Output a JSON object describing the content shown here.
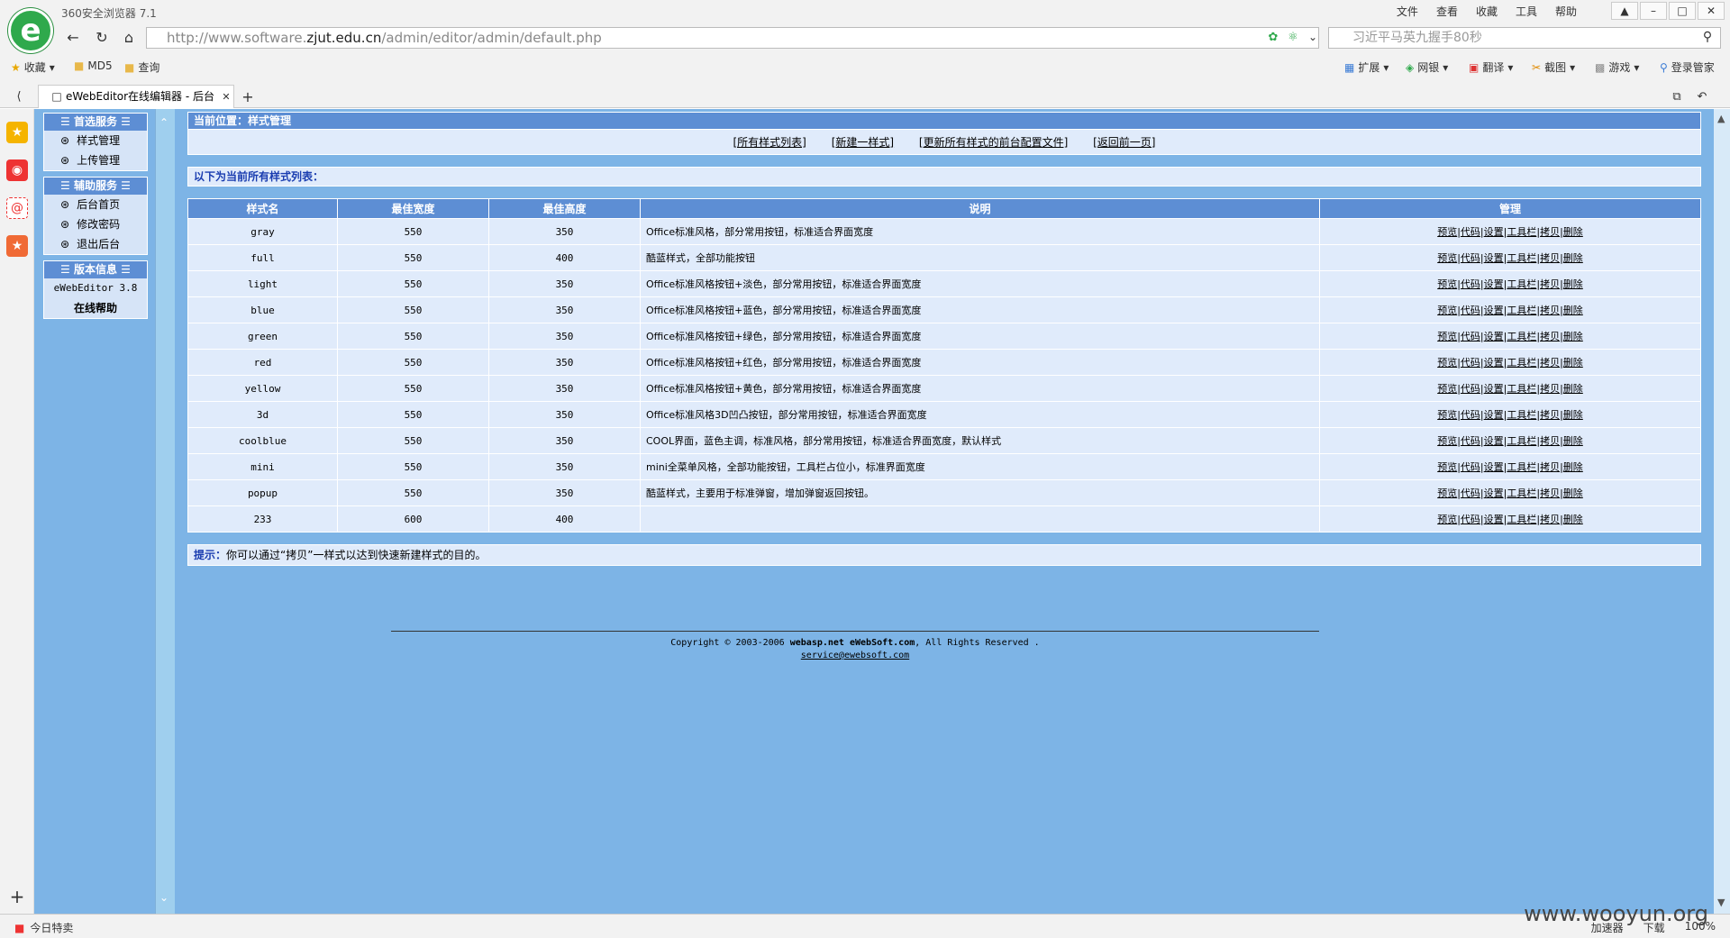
{
  "browser": {
    "app_name": "360安全浏览器 7.1",
    "menus": [
      "文件",
      "查看",
      "收藏",
      "工具",
      "帮助"
    ],
    "url_prefix": "http://www.software.",
    "url_host": "zjut.edu.cn",
    "url_path": "/admin/editor/admin/default.php",
    "search_text": "习近平马英九握手80秒",
    "bookmarks": [
      "收藏",
      "MD5",
      "查询"
    ],
    "toolbar_items": [
      "扩展",
      "网银",
      "翻译",
      "截图",
      "游戏",
      "登录管家"
    ],
    "tab_title": "eWebEditor在线编辑器 - 后台",
    "status_left": "今日特卖",
    "status_right": [
      "加速器",
      "下载",
      "100%"
    ],
    "watermark": "www.wooyun.org"
  },
  "sidebar": {
    "sections": [
      {
        "title": "首选服务",
        "items": [
          "样式管理",
          "上传管理"
        ]
      },
      {
        "title": "辅助服务",
        "items": [
          "后台首页",
          "修改密码",
          "退出后台"
        ]
      }
    ],
    "version_title": "版本信息",
    "version_text": "eWebEditor 3.8",
    "help_text": "在线帮助"
  },
  "main": {
    "location": "当前位置：样式管理",
    "links": [
      "[所有样式列表]",
      "[新建一样式]",
      "[更新所有样式的前台配置文件]",
      "[返回前一页]"
    ],
    "list_header": "以下为当前所有样式列表：",
    "columns": [
      "样式名",
      "最佳宽度",
      "最佳高度",
      "说明",
      "管理"
    ],
    "actions": [
      "预览",
      "代码",
      "设置",
      "工具栏",
      "拷贝",
      "删除"
    ],
    "rows": [
      {
        "name": "gray",
        "width": "550",
        "height": "350",
        "desc": "Office标准风格，部分常用按钮，标准适合界面宽度"
      },
      {
        "name": "full",
        "width": "550",
        "height": "400",
        "desc": "酷蓝样式，全部功能按钮"
      },
      {
        "name": "light",
        "width": "550",
        "height": "350",
        "desc": "Office标准风格按钮+淡色，部分常用按钮，标准适合界面宽度"
      },
      {
        "name": "blue",
        "width": "550",
        "height": "350",
        "desc": "Office标准风格按钮+蓝色，部分常用按钮，标准适合界面宽度"
      },
      {
        "name": "green",
        "width": "550",
        "height": "350",
        "desc": "Office标准风格按钮+绿色，部分常用按钮，标准适合界面宽度"
      },
      {
        "name": "red",
        "width": "550",
        "height": "350",
        "desc": "Office标准风格按钮+红色，部分常用按钮，标准适合界面宽度"
      },
      {
        "name": "yellow",
        "width": "550",
        "height": "350",
        "desc": "Office标准风格按钮+黄色，部分常用按钮，标准适合界面宽度"
      },
      {
        "name": "3d",
        "width": "550",
        "height": "350",
        "desc": "Office标准风格3D凹凸按钮，部分常用按钮，标准适合界面宽度"
      },
      {
        "name": "coolblue",
        "width": "550",
        "height": "350",
        "desc": "COOL界面，蓝色主调，标准风格，部分常用按钮，标准适合界面宽度，默认样式"
      },
      {
        "name": "mini",
        "width": "550",
        "height": "350",
        "desc": "mini全菜单风格，全部功能按钮，工具栏占位小，标准界面宽度"
      },
      {
        "name": "popup",
        "width": "550",
        "height": "350",
        "desc": "酷蓝样式，主要用于标准弹窗，增加弹窗返回按钮。"
      },
      {
        "name": "233",
        "width": "600",
        "height": "400",
        "desc": ""
      }
    ],
    "tip_label": "提示：",
    "tip_text": "你可以通过“拷贝”一样式以达到快速新建样式的目的。"
  },
  "footer": {
    "copyright_prefix": "Copyright © 2003-2006",
    "brand1": "webasp.net",
    "brand2": "eWebSoft.com",
    "copyright_suffix": ", All Rights Reserved .",
    "email": "service@ewebsoft.com"
  },
  "colors": {
    "content_bg": "#7db4e6",
    "header_bg": "#5d8ed4",
    "row_bg": "#e0ebfb",
    "logo_green": "#2fa94c"
  }
}
